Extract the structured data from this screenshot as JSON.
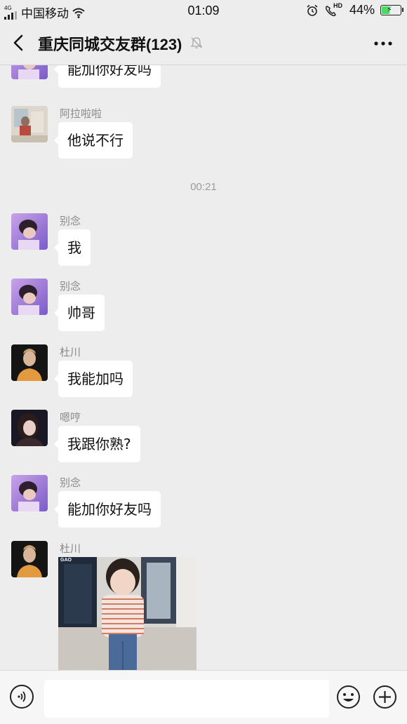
{
  "status_bar": {
    "network": "4G",
    "carrier": "中国移动",
    "time": "01:09",
    "hd": "HD",
    "battery": "44%",
    "battery_level": 0.44
  },
  "header": {
    "title": "重庆同城交友群",
    "member_count": "(123)"
  },
  "messages": [
    {
      "sender": "",
      "text": "能加你好友吗"
    },
    {
      "sender": "阿拉啦啦",
      "text": "他说不行"
    },
    {
      "timestamp": "00:21"
    },
    {
      "sender": "别念",
      "text": "我"
    },
    {
      "sender": "别念",
      "text": "帅哥"
    },
    {
      "sender": "杜川",
      "text": "我能加吗"
    },
    {
      "sender": "嗯哼",
      "text": "我跟你熟?"
    },
    {
      "sender": "别念",
      "text": "能加你好友吗"
    },
    {
      "sender": "杜川",
      "image_watermark": "GAO"
    }
  ],
  "input": {
    "value": "",
    "placeholder": ""
  },
  "icons": [
    "back-icon",
    "mute-icon",
    "more-icon",
    "voice-icon",
    "emoji-icon",
    "plus-icon",
    "wifi-icon",
    "alarm-icon",
    "phone-hd-icon"
  ]
}
